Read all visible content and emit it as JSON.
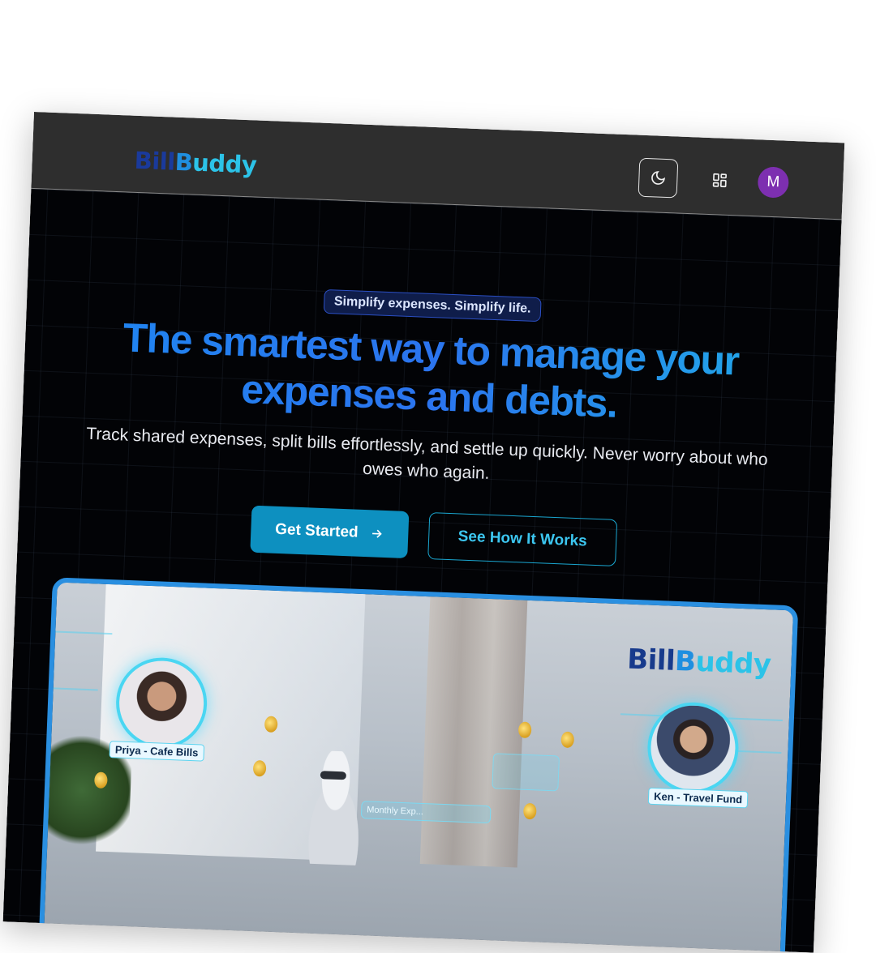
{
  "brand": {
    "logo_part1": "Bill",
    "logo_part2": "B",
    "logo_part3": "uddy",
    "colors": {
      "navy": "#1a3a9c",
      "blue": "#1f8fe0",
      "cyan": "#2cc3e8"
    }
  },
  "header": {
    "theme_icon": "moon-icon",
    "apps_icon": "grid-icon",
    "avatar_initial": "M",
    "avatar_color": "#7d2fb0"
  },
  "hero": {
    "tagline": "Simplify expenses. Simplify life.",
    "headline": "The smartest way to manage your expenses and debts.",
    "subtitle": "Track shared expenses, split bills effortlessly, and settle up quickly. Never worry about who owes who again.",
    "primary_cta": "Get Started",
    "primary_cta_icon": "arrow-right-icon",
    "secondary_cta": "See How It Works",
    "accent_color": "#0d90c0"
  },
  "preview": {
    "brand_part1": "Bill",
    "brand_part2": "B",
    "brand_part3": "uddy",
    "profile_left_label": "Priya - Cafe Bills",
    "profile_right_label": "Ken - Travel Fund",
    "holo_text": "Monthly Exp..."
  }
}
